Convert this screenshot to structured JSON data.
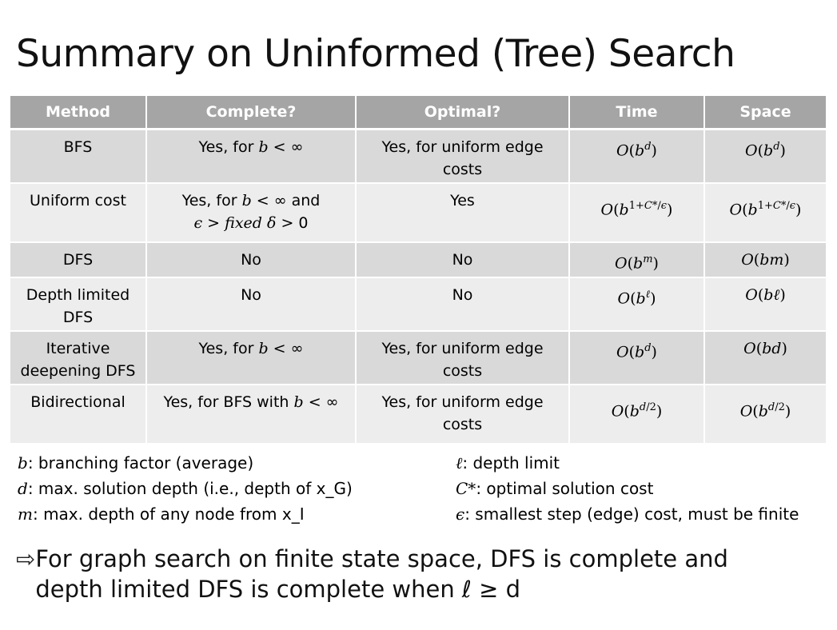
{
  "title": "Summary on Uninformed (Tree) Search",
  "table": {
    "headers": [
      "Method",
      "Complete?",
      "Optimal?",
      "Time",
      "Space"
    ],
    "rows": [
      {
        "method": "BFS",
        "complete": "Yes, for b < ∞",
        "optimal": "Yes, for uniform edge costs",
        "time": "O(b^d)",
        "space": "O(b^d)"
      },
      {
        "method": "Uniform cost",
        "complete": "Yes, for b < ∞ and ϵ > fixed δ > 0",
        "optimal": "Yes",
        "time": "O(b^(1+C*/ϵ))",
        "space": "O(b^(1+C*/ϵ))"
      },
      {
        "method": "DFS",
        "complete": "No",
        "optimal": "No",
        "time": "O(b^m)",
        "space": "O(bm)"
      },
      {
        "method": "Depth limited DFS",
        "complete": "No",
        "optimal": "No",
        "time": "O(b^ℓ)",
        "space": "O(bℓ)"
      },
      {
        "method": "Iterative deepening DFS",
        "complete": "Yes, for b < ∞",
        "optimal": "Yes, for uniform edge costs",
        "time": "O(b^d)",
        "space": "O(bd)"
      },
      {
        "method": "Bidirectional",
        "complete": "Yes, for BFS with b < ∞",
        "optimal": "Yes, for uniform edge costs",
        "time": "O(b^(d/2))",
        "space": "O(b^(d/2))"
      }
    ]
  },
  "legend_left": [
    {
      "symbol": "b",
      "text": ": branching factor (average)"
    },
    {
      "symbol": "d",
      "text": ": max. solution depth (i.e., depth of x_G)"
    },
    {
      "symbol": "m",
      "text": ": max. depth of any node from x_I"
    }
  ],
  "legend_right": [
    {
      "symbol": "ℓ",
      "text": ": depth limit"
    },
    {
      "symbol": "C*",
      "text": ": optimal solution cost"
    },
    {
      "symbol": "ϵ",
      "text": ": smallest step (edge) cost, must be finite"
    }
  ],
  "note": {
    "arrow": "⇨",
    "text": "For graph search on finite state space, DFS is complete and depth limited DFS is complete when ℓ ≥ d"
  }
}
